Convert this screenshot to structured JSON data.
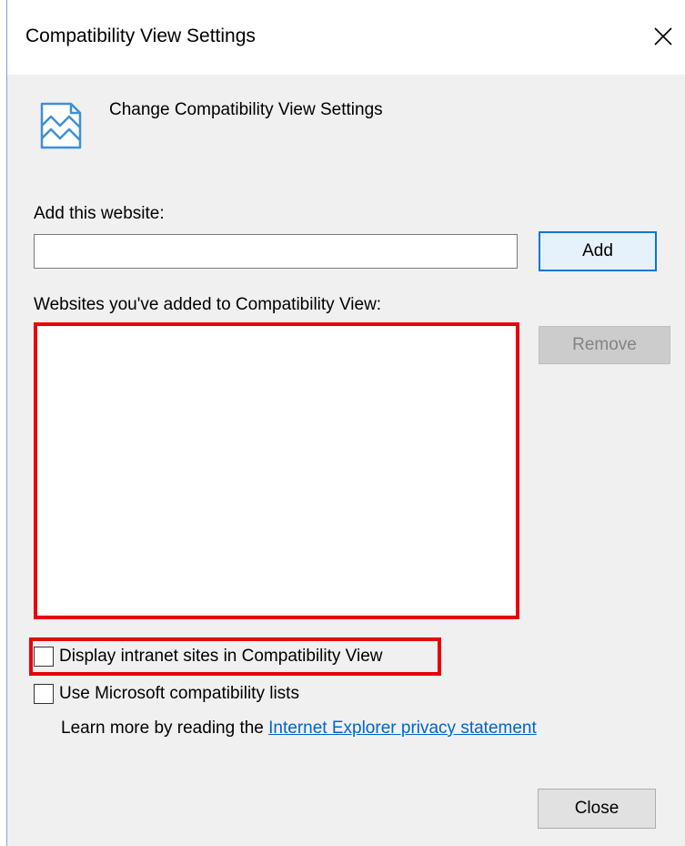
{
  "window": {
    "title": "Compatibility View Settings",
    "close_glyph": "✕"
  },
  "header": {
    "icon": "compatibility-view-icon",
    "text": "Change Compatibility View Settings"
  },
  "add_section": {
    "label": "Add this website:",
    "input_value": "",
    "add_label": "Add"
  },
  "list_section": {
    "label": "Websites you've added to Compatibility View:",
    "items": [],
    "remove_label": "Remove"
  },
  "options": {
    "intranet": {
      "label": "Display intranet sites in Compatibility View",
      "checked": false
    },
    "microsoft_lists": {
      "label": "Use Microsoft compatibility lists",
      "checked": false
    }
  },
  "learn_more": {
    "prefix": "Learn more by reading the ",
    "link_text": "Internet Explorer privacy statement"
  },
  "footer": {
    "close_label": "Close"
  },
  "colors": {
    "accent": "#0078d7",
    "highlight": "#e8000b",
    "link": "#0066cc"
  }
}
